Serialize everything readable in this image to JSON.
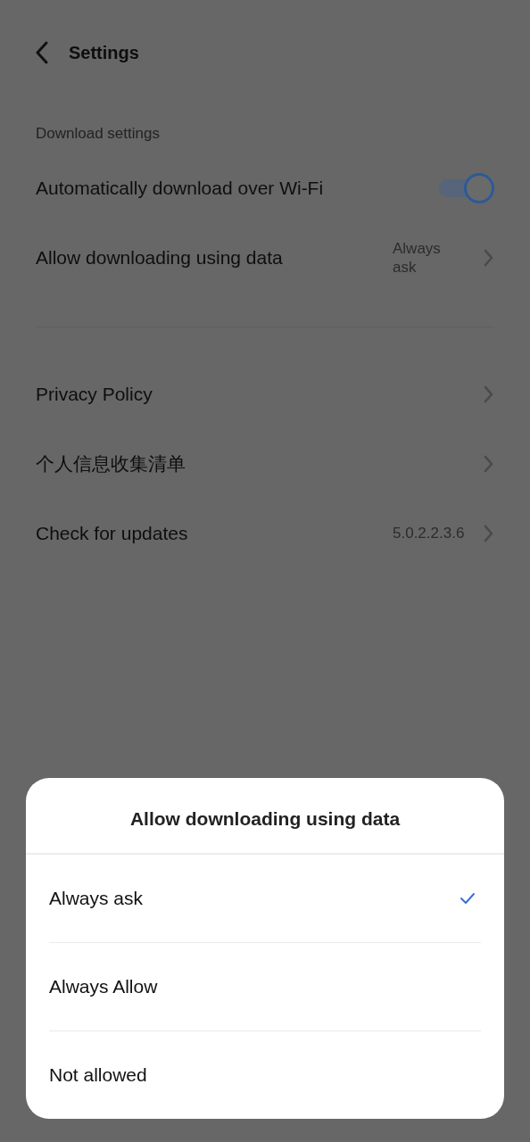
{
  "header": {
    "title": "Settings"
  },
  "sections": [
    {
      "label": "Download settings",
      "rows": [
        {
          "kind": "toggle",
          "label": "Automatically download over Wi-Fi",
          "on": true
        },
        {
          "kind": "link",
          "label": "Allow downloading using data",
          "value": "Always ask"
        }
      ]
    },
    {
      "rows": [
        {
          "kind": "link",
          "label": "Privacy Policy"
        },
        {
          "kind": "link",
          "label": "个人信息收集清单"
        },
        {
          "kind": "link",
          "label": "Check for updates",
          "value": "5.0.2.2.3.6"
        }
      ]
    }
  ],
  "sheet": {
    "title": "Allow downloading using data",
    "options": [
      {
        "label": "Always ask",
        "selected": true
      },
      {
        "label": "Always Allow",
        "selected": false
      },
      {
        "label": "Not allowed",
        "selected": false
      }
    ]
  }
}
